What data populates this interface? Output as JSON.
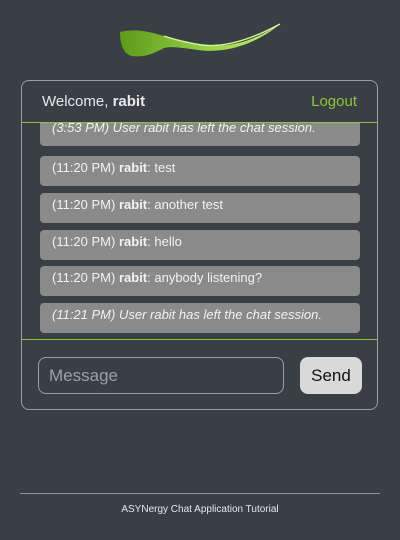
{
  "header": {
    "welcome_prefix": "Welcome, ",
    "username": "rabit",
    "logout_label": "Logout"
  },
  "messages": [
    {
      "type": "system",
      "text": "(3:53 PM) User rabit has left the chat session."
    },
    {
      "type": "chat",
      "time": "(11:20 PM)",
      "user": "rabit",
      "text": ": test"
    },
    {
      "type": "chat",
      "time": "(11:20 PM)",
      "user": "rabit",
      "text": ": another test"
    },
    {
      "type": "chat",
      "time": "(11:20 PM)",
      "user": "rabit",
      "text": ": hello"
    },
    {
      "type": "chat",
      "time": "(11:20 PM)",
      "user": "rabit",
      "text": ": anybody listening?"
    },
    {
      "type": "system",
      "text": "(11:21 PM) User rabit has left the chat session."
    }
  ],
  "composer": {
    "placeholder": "Message",
    "value": "",
    "send_label": "Send"
  },
  "footer": {
    "text": "ASYNergy Chat Application Tutorial"
  },
  "colors": {
    "background": "#3a3f46",
    "accent": "#8cc63f",
    "message_bubble": "#8a8a8a"
  },
  "logo": {
    "icon": "swoosh-leaf-logo"
  }
}
